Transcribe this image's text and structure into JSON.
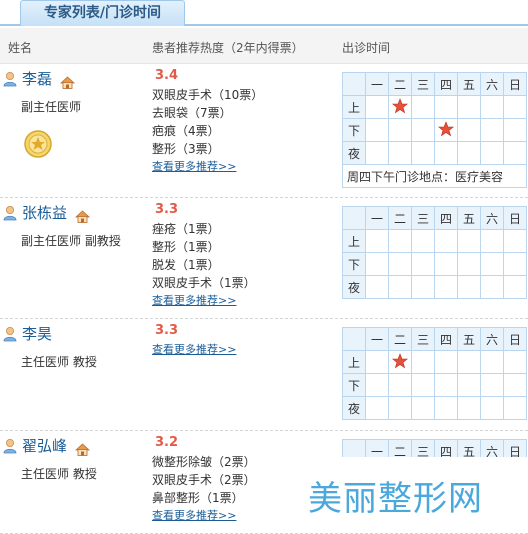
{
  "tab": {
    "label": "专家列表/门诊时间"
  },
  "header": {
    "col_name": "姓名",
    "col_recommend": "患者推荐热度（2年内得票）",
    "col_clinic": "出诊时间"
  },
  "schedule_labels": {
    "days": [
      "一",
      "二",
      "三",
      "四",
      "五",
      "六",
      "日"
    ],
    "periods": [
      "上",
      "下",
      "夜"
    ]
  },
  "doctors": [
    {
      "name": "李磊",
      "title": "副主任医师",
      "score": "3.4",
      "votes": [
        "双眼皮手术（10票）",
        "去眼袋（7票）",
        "疤痕（4票）",
        "整形（3票）"
      ],
      "more_link": "查看更多推荐>>",
      "schedule_marks": [
        [
          1,
          1
        ],
        [
          2,
          3
        ]
      ],
      "schedule_note": "周四下午门诊地点：医疗美容",
      "has_medal": true
    },
    {
      "name": "张栋益",
      "title": "副主任医师  副教授",
      "score": "3.3",
      "votes": [
        "痤疮（1票）",
        "整形（1票）",
        "脱发（1票）",
        "双眼皮手术（1票）"
      ],
      "more_link": "查看更多推荐>>",
      "schedule_marks": [],
      "schedule_note": ""
    },
    {
      "name": "李昊",
      "title": "主任医师  教授",
      "score": "3.3",
      "votes": [],
      "more_link": "查看更多推荐>>",
      "schedule_marks": [
        [
          1,
          1
        ]
      ],
      "schedule_note": ""
    },
    {
      "name": "翟弘峰",
      "title": "主任医师  教授",
      "score": "3.2",
      "votes": [
        "微整形除皱（2票）",
        "双眼皮手术（2票）",
        "鼻部整形（1票）"
      ],
      "more_link": "查看更多推荐>>",
      "schedule_marks": [],
      "schedule_note": ""
    }
  ],
  "watermark": {
    "text": "美丽整形网"
  },
  "colors": {
    "accent": "#1a5d98",
    "score": "#e25a4a",
    "table_border": "#b9d6ee",
    "star": "#e8503a"
  }
}
